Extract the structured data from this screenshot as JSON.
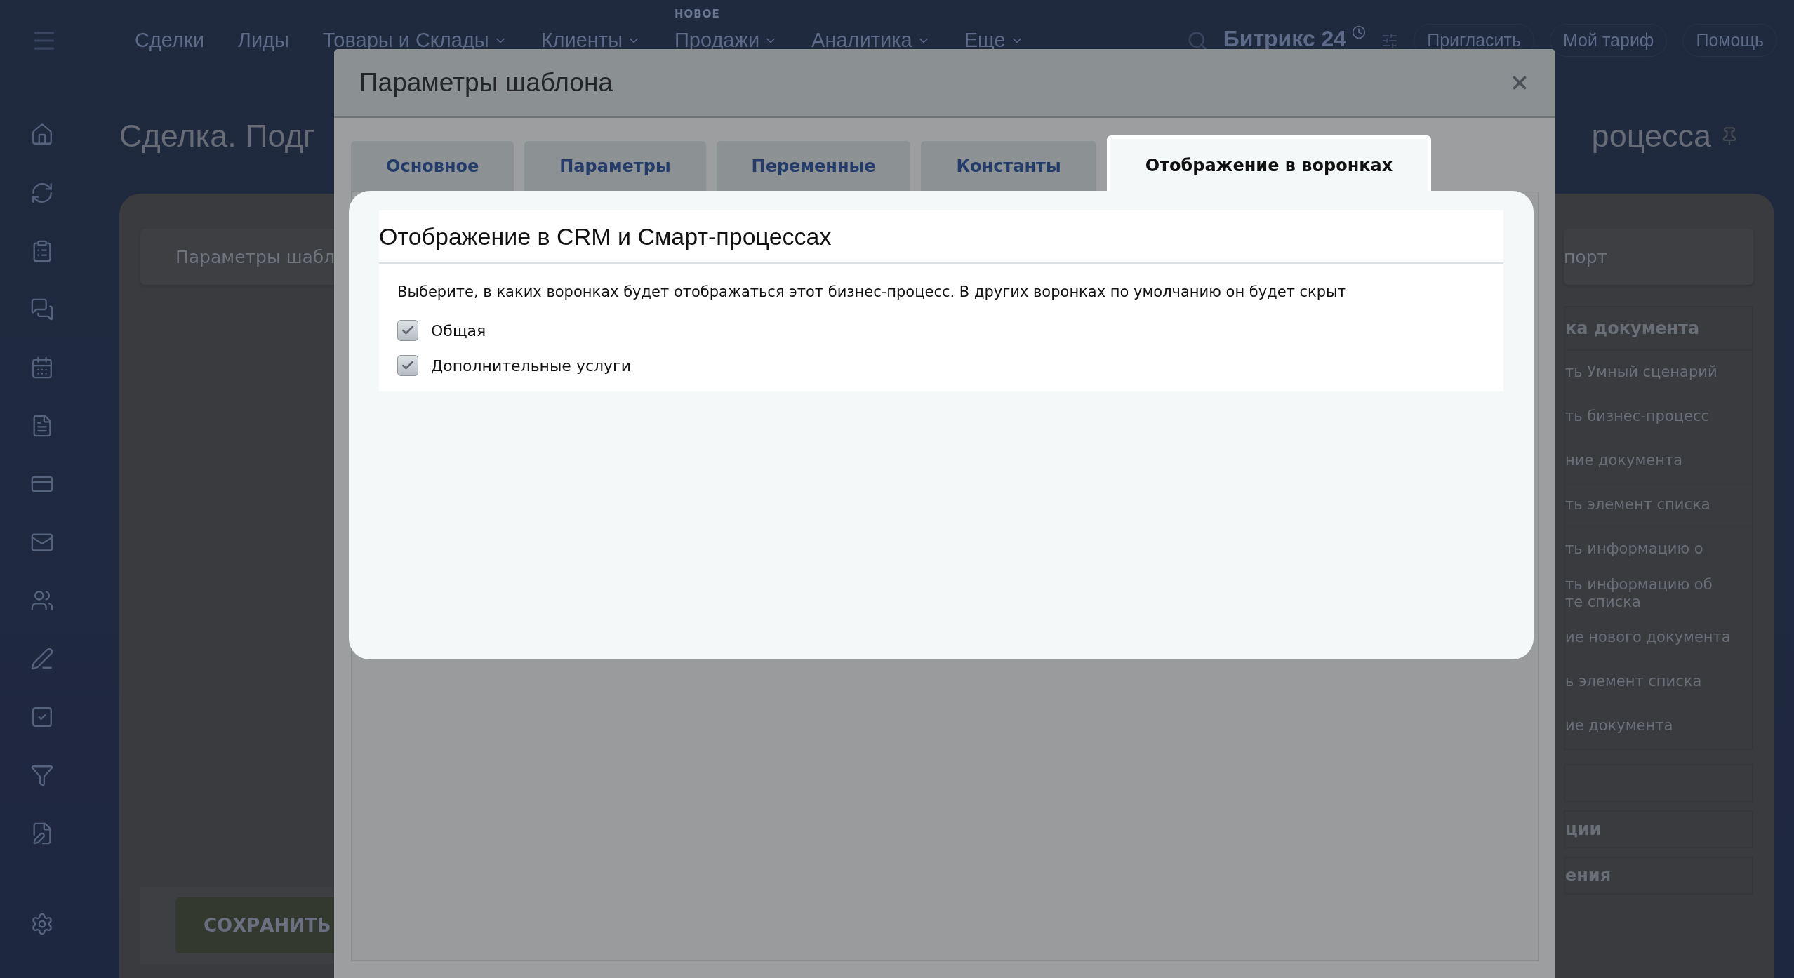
{
  "top_bar": {
    "nav": [
      {
        "label": "Сделки",
        "dropdown": false
      },
      {
        "label": "Лиды",
        "dropdown": false
      },
      {
        "label": "Товары и Склады",
        "dropdown": true
      },
      {
        "label": "Клиенты",
        "dropdown": true
      },
      {
        "label": "Продажи",
        "dropdown": true,
        "badge": "НОВОЕ"
      },
      {
        "label": "Аналитика",
        "dropdown": true
      },
      {
        "label": "Еще",
        "dropdown": true
      }
    ],
    "logo": "Битрикс 24",
    "actions": [
      "Пригласить",
      "Мой тариф",
      "Помощь"
    ]
  },
  "page": {
    "title_left": "Сделка. Подг",
    "title_right": "роцесса"
  },
  "card": {
    "left_field": "Параметры шабл",
    "right_field": "порт",
    "activity_panel": {
      "header": "ка документа",
      "items": [
        "ть Умный сценарий",
        "ть бизнес-процесс",
        "ние документа",
        "ть элемент списка",
        "ть информацию о",
        "ть информацию об\nте списка",
        "ие нового документа",
        "ь элемент списка",
        "ие документа"
      ]
    },
    "groups": [
      "ции",
      "ения"
    ],
    "save_button": "СОХРАНИТЬ"
  },
  "dialog": {
    "title": "Параметры шаблона",
    "tabs": [
      {
        "label": "Основное",
        "selected": false
      },
      {
        "label": "Параметры",
        "selected": false
      },
      {
        "label": "Переменные",
        "selected": false
      },
      {
        "label": "Константы",
        "selected": false
      },
      {
        "label": "Отображение в воронках",
        "selected": true
      }
    ],
    "section": {
      "title": "Отображение в CRM и Смарт-процессах",
      "description": "Выберите, в каких воронках будет отображаться этот бизнес-процесс. В других воронках по умолчанию он будет скрыт",
      "options": [
        {
          "label": "Общая",
          "checked": true
        },
        {
          "label": "Дополнительные услуги",
          "checked": true
        }
      ]
    }
  }
}
